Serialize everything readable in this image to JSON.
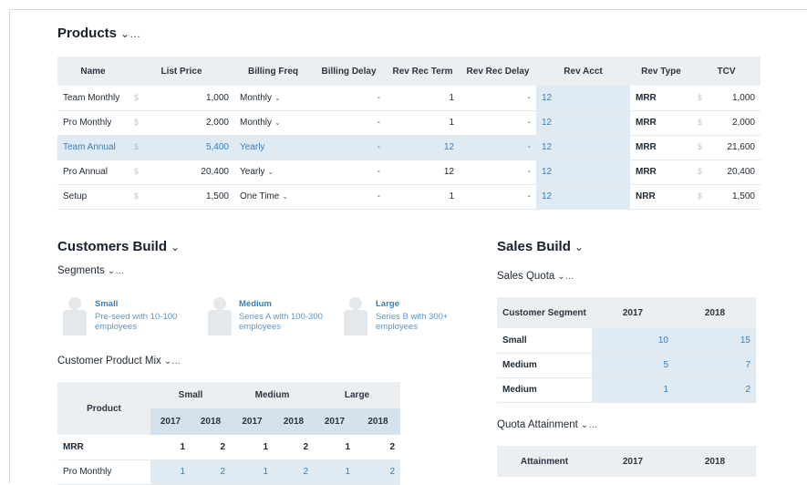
{
  "products": {
    "title": "Products",
    "title_chev": "⌄…",
    "columns": [
      "Name",
      "List Price",
      "Billing Freq",
      "Billing Delay",
      "Rev Rec Term",
      "Rev Rec Delay",
      "Rev Acct",
      "Rev Type",
      "TCV"
    ],
    "rows": [
      {
        "name": "Team Monthly",
        "price": "1,000",
        "freq": "Monthly",
        "delay": "-",
        "term": "1",
        "rdelay": "-",
        "acct": "12",
        "type": "MRR",
        "tcv": "1,000"
      },
      {
        "name": "Pro Monthly",
        "price": "2,000",
        "freq": "Monthly",
        "delay": "-",
        "term": "1",
        "rdelay": "-",
        "acct": "12",
        "type": "MRR",
        "tcv": "2,000"
      },
      {
        "name": "Team Annual",
        "price": "5,400",
        "freq": "Yearly",
        "delay": "-",
        "term": "12",
        "rdelay": "-",
        "acct": "12",
        "type": "MRR",
        "tcv": "21,600"
      },
      {
        "name": "Pro Annual",
        "price": "20,400",
        "freq": "Yearly",
        "delay": "-",
        "term": "12",
        "rdelay": "-",
        "acct": "12",
        "type": "MRR",
        "tcv": "20,400"
      },
      {
        "name": "Setup",
        "price": "1,500",
        "freq": "One Time",
        "delay": "-",
        "term": "1",
        "rdelay": "-",
        "acct": "12",
        "type": "NRR",
        "tcv": "1,500"
      }
    ],
    "currency": "$",
    "highlighted_row": 2
  },
  "customers": {
    "title": "Customers Build",
    "title_chev": "⌄",
    "segments_label": "Segments",
    "segments_chev": "⌄…",
    "segments": [
      {
        "name": "Small",
        "desc": "Pre-seed with 10-100 employees"
      },
      {
        "name": "Medium",
        "desc": "Series A with 100-300 employees"
      },
      {
        "name": "Large",
        "desc": "Series B with 300+ employees"
      }
    ],
    "mix_label": "Customer Product Mix",
    "mix_chev": "⌄…",
    "mix": {
      "product_header": "Product",
      "groups": [
        "Small",
        "Medium",
        "Large"
      ],
      "years": [
        "2017",
        "2018",
        "2017",
        "2018",
        "2017",
        "2018"
      ],
      "rows": [
        {
          "label": "MRR",
          "values": [
            "1",
            "2",
            "1",
            "2",
            "1",
            "2"
          ]
        },
        {
          "label": "Pro Monthly",
          "values": [
            "1",
            "2",
            "1",
            "2",
            "1",
            "2"
          ]
        }
      ]
    }
  },
  "sales": {
    "title": "Sales Build",
    "title_chev": "⌄",
    "quota_label": "Sales Quota",
    "quota_chev": "⌄…",
    "quota": {
      "headers": [
        "Customer Segment",
        "2017",
        "2018"
      ],
      "rows": [
        {
          "label": "Small",
          "v2017": "10",
          "v2018": "15"
        },
        {
          "label": "Medium",
          "v2017": "5",
          "v2018": "7"
        },
        {
          "label": "Medium",
          "v2017": "1",
          "v2018": "2"
        }
      ]
    },
    "attain_label": "Quota Attainment",
    "attain_chev": "⌄…",
    "attain_headers": [
      "Attainment",
      "2017",
      "2018"
    ]
  },
  "icons": {
    "dropdown": "chevron-down-icon",
    "avatar": "person-icon"
  },
  "colors": {
    "accent": "#3a7fb8",
    "highlight_bg": "#dfeaf3",
    "header_bg": "#eceff2"
  }
}
